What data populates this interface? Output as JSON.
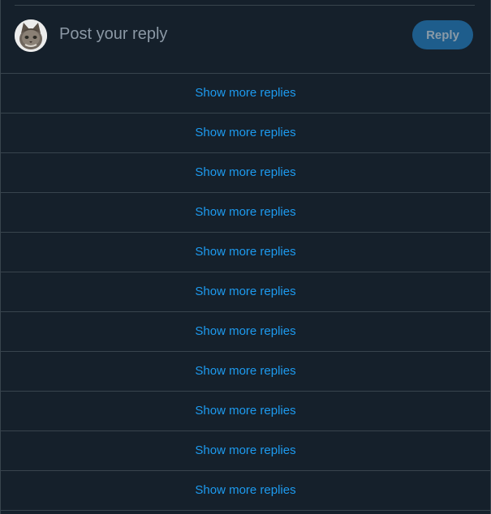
{
  "composer": {
    "placeholder": "Post your reply",
    "reply_label": "Reply"
  },
  "replies": {
    "items": [
      {
        "label": "Show more replies"
      },
      {
        "label": "Show more replies"
      },
      {
        "label": "Show more replies"
      },
      {
        "label": "Show more replies"
      },
      {
        "label": "Show more replies"
      },
      {
        "label": "Show more replies"
      },
      {
        "label": "Show more replies"
      },
      {
        "label": "Show more replies"
      },
      {
        "label": "Show more replies"
      },
      {
        "label": "Show more replies"
      },
      {
        "label": "Show more replies"
      }
    ]
  },
  "colors": {
    "background": "#15202b",
    "border": "#38444d",
    "link": "#1d9bf0",
    "reply_button_bg": "#1e5d8c",
    "placeholder": "#8b98a5"
  },
  "icons": {
    "avatar": "cat-avatar"
  }
}
